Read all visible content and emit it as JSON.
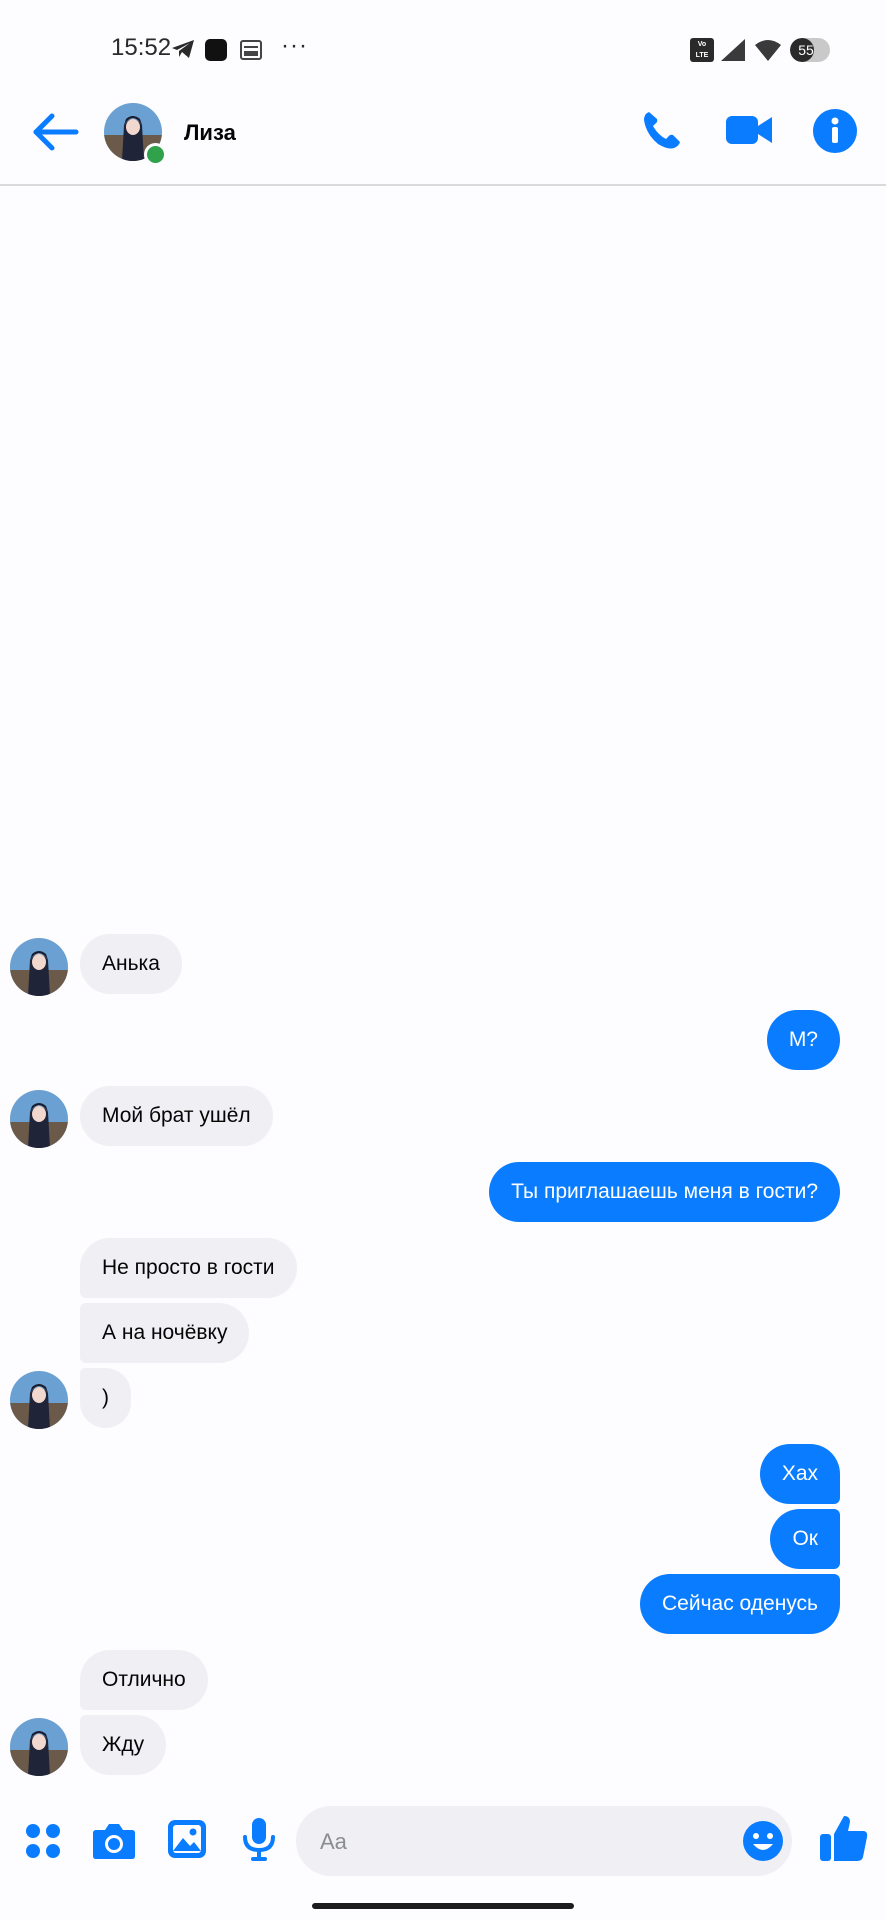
{
  "status_bar": {
    "time": "15:52",
    "icons": [
      "telegram-icon",
      "app-square-icon",
      "hd-icon",
      "more-dots-icon",
      "volte-icon",
      "signal-icon",
      "wifi-icon",
      "battery-icon"
    ],
    "more": "···",
    "volte_top": "Vo",
    "volte_bottom": "LTE",
    "battery": "55"
  },
  "header": {
    "contact_name": "Лиза",
    "online": true,
    "icons": [
      "back-arrow-icon",
      "phone-icon",
      "video-camera-icon",
      "info-icon"
    ]
  },
  "messages": [
    {
      "side": "in",
      "text": "Анька"
    },
    {
      "side": "out",
      "text": "М?"
    },
    {
      "side": "in",
      "text": "Мой брат ушёл"
    },
    {
      "side": "out",
      "text": "Ты приглашаешь меня в гости?"
    },
    {
      "side": "in",
      "text": "Не просто в гости"
    },
    {
      "side": "in",
      "text": "А на ночёвку"
    },
    {
      "side": "in",
      "text": ")"
    },
    {
      "side": "out",
      "text": "Хах"
    },
    {
      "side": "out",
      "text": "Ок"
    },
    {
      "side": "out",
      "text": "Сейчас оденусь"
    },
    {
      "side": "in",
      "text": "Отлично"
    },
    {
      "side": "in",
      "text": "Жду"
    }
  ],
  "composer": {
    "placeholder": "Aa",
    "icons": [
      "apps-grid-icon",
      "camera-icon",
      "image-icon",
      "microphone-icon",
      "emoji-icon",
      "thumbs-up-icon"
    ]
  },
  "colors": {
    "accent": "#0a7cff",
    "incoming_bubble": "#f0eff3",
    "online": "#31a24c"
  }
}
